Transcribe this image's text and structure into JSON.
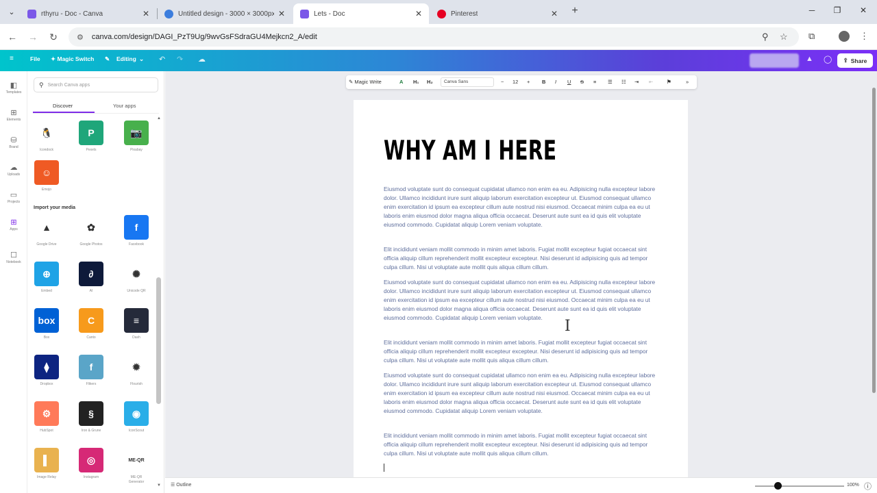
{
  "browser": {
    "tabs": [
      {
        "title": "rthyru - Doc - Canva",
        "favicon_color": "#7b58e8"
      },
      {
        "title": "Untitled design - 3000 × 3000px",
        "favicon_color": "#3b7ddd"
      },
      {
        "title": "Lets - Doc",
        "favicon_color": "#7b58e8"
      },
      {
        "title": "Pinterest",
        "favicon_color": "#e60023"
      }
    ],
    "new_tab": "+",
    "url": "canva.com/design/DAGI_PzT9Ug/9wvGsFSdraGU4Mejkcn2_A/edit"
  },
  "canva_header": {
    "menu_icon": "≡",
    "file": "File",
    "magic_switch": "✦ Magic Switch",
    "editing": "Editing",
    "share": "Share"
  },
  "rail": [
    {
      "label": "Templates",
      "icon": "◧"
    },
    {
      "label": "Elements",
      "icon": "⊞"
    },
    {
      "label": "Brand",
      "icon": "⛁"
    },
    {
      "label": "Uploads",
      "icon": "☁"
    },
    {
      "label": "Projects",
      "icon": "▭"
    },
    {
      "label": "Apps",
      "icon": "⊞"
    },
    {
      "label": "Notebook",
      "icon": "☐"
    }
  ],
  "panel": {
    "search_placeholder": "Search Canva apps",
    "tabs": [
      "Discover",
      "Your apps"
    ],
    "section_import": "Import your media",
    "apps_top": [
      {
        "label": "Icondock",
        "color": "#ffffff",
        "glyph": "🐧"
      },
      {
        "label": "Pexels",
        "color": "#1fa67a",
        "glyph": "P"
      },
      {
        "label": "Pixabay",
        "color": "#48b04c",
        "glyph": "📷"
      },
      {
        "label": "Emojo",
        "color": "#ef5a24",
        "glyph": "☺"
      }
    ],
    "apps_import": [
      {
        "label": "Google Drive",
        "color": "#ffffff",
        "glyph": "▲"
      },
      {
        "label": "Google Photos",
        "color": "#ffffff",
        "glyph": "✿"
      },
      {
        "label": "Facebook",
        "color": "#1877f2",
        "glyph": "f"
      },
      {
        "label": "Embed",
        "color": "#1fa3e6",
        "glyph": "⊕"
      },
      {
        "label": "AI",
        "color": "#0e1a3a",
        "glyph": "∂"
      },
      {
        "label": "Unicode QR",
        "color": "#ffffff",
        "glyph": "✺"
      },
      {
        "label": "Box",
        "color": "#0061d5",
        "glyph": "box"
      },
      {
        "label": "Canto",
        "color": "#f79a1c",
        "glyph": "C"
      },
      {
        "label": "Dash",
        "color": "#252a3a",
        "glyph": "≡"
      },
      {
        "label": "Dropbox",
        "color": "#0d2481",
        "glyph": "⧫"
      },
      {
        "label": "Flikers",
        "color": "#5aa5c8",
        "glyph": "f"
      },
      {
        "label": "Flourish",
        "color": "#ffffff",
        "glyph": "✹"
      },
      {
        "label": "HubSpot",
        "color": "#ff7a59",
        "glyph": "⚙"
      },
      {
        "label": "Iron & Grune",
        "color": "#222222",
        "glyph": "§"
      },
      {
        "label": "IconScout",
        "color": "#2aaee8",
        "glyph": "◉"
      },
      {
        "label": "Image Relay",
        "color": "#e9b24f",
        "glyph": "▌"
      },
      {
        "label": "Instagram",
        "color": "#d62976",
        "glyph": "◎"
      },
      {
        "label": "ME-QR Generator",
        "color": "#ffffff",
        "glyph": "ME-QR"
      }
    ]
  },
  "toolbar": {
    "magic_write": "Magic Write",
    "font": "Canva Sans",
    "size": "12"
  },
  "doc": {
    "title": "WHY AM I HERE",
    "para_a": "Eiusmod voluptate sunt do consequat cupidatat ullamco non enim ea eu. Adipisicing nulla excepteur labore dolor. Ullamco incididunt irure sunt aliquip laborum exercitation excepteur ut. Eiusmod consequat ullamco enim exercitation id ipsum ea excepteur cillum aute nostrud nisi eiusmod. Occaecat minim culpa ea eu ut laboris enim eiusmod dolor magna aliqua officia occaecat. Deserunt aute sunt ea id quis elit voluptate eiusmod commodo. Cupidatat aliquip Lorem veniam voluptate.",
    "para_b": "Elit incididunt veniam mollit commodo in minim amet laboris. Fugiat mollit excepteur fugiat occaecat sint officia aliquip cillum reprehenderit mollit excepteur excepteur. Nisi deserunt id adipisicing quis ad tempor culpa cillum. Nisi ut voluptate aute mollit quis aliqua cillum cillum."
  },
  "footer": {
    "outline": "Outline",
    "zoom": "100%"
  }
}
